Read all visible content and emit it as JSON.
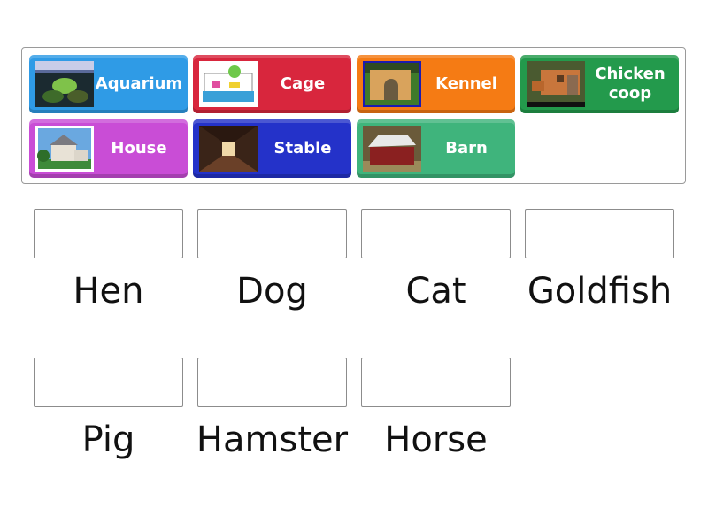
{
  "tiles": [
    {
      "label": "Aquarium",
      "image": "aquarium-photo",
      "color": "#2f9be6"
    },
    {
      "label": "Cage",
      "image": "hamster-cage-photo",
      "color": "#d8263d"
    },
    {
      "label": "Kennel",
      "image": "dog-kennel-photo",
      "color": "#f57b14"
    },
    {
      "label": "Chicken coop",
      "image": "chicken-coop-photo",
      "color": "#239a4c"
    },
    {
      "label": "House",
      "image": "house-photo",
      "color": "#c94dd6"
    },
    {
      "label": "Stable",
      "image": "stable-photo",
      "color": "#2432c9"
    },
    {
      "label": "Barn",
      "image": "barn-photo",
      "color": "#3fb47c"
    }
  ],
  "targets": [
    {
      "label": "Hen"
    },
    {
      "label": "Dog"
    },
    {
      "label": "Cat"
    },
    {
      "label": "Goldfish"
    },
    {
      "label": "Pig"
    },
    {
      "label": "Hamster"
    },
    {
      "label": "Horse"
    }
  ]
}
